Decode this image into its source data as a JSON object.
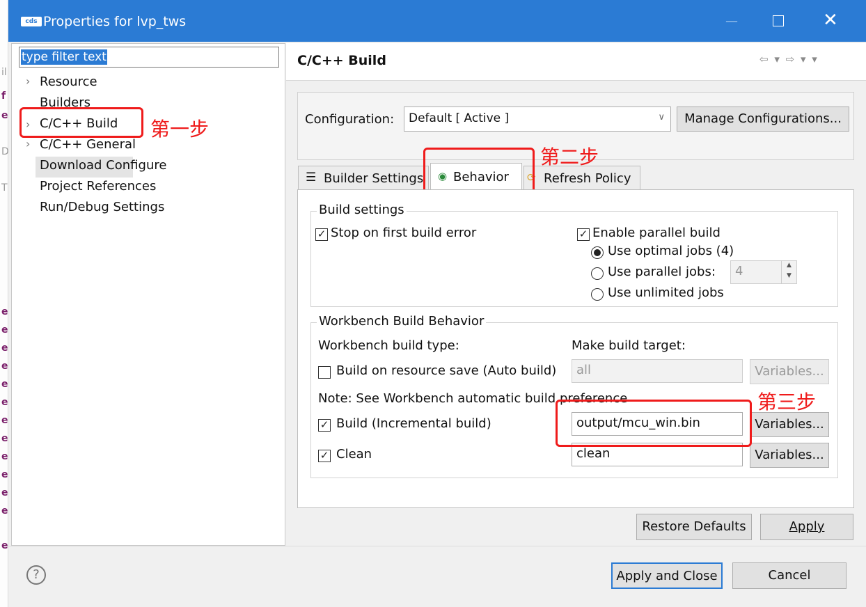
{
  "window": {
    "title": "Properties for lvp_tws",
    "logo": "cds"
  },
  "filter": {
    "value": "type filter text"
  },
  "tree": [
    {
      "label": "Resource",
      "expandable": true
    },
    {
      "label": "Builders",
      "expandable": false
    },
    {
      "label": "C/C++ Build",
      "expandable": true,
      "selected": true
    },
    {
      "label": "C/C++ General",
      "expandable": true
    },
    {
      "label": "Download Configure",
      "expandable": false
    },
    {
      "label": "Project References",
      "expandable": false
    },
    {
      "label": "Run/Debug Settings",
      "expandable": false
    }
  ],
  "annotations": {
    "step1": "第一步",
    "step2": "第二步",
    "step3": "第三步"
  },
  "page": {
    "title": "C/C++ Build"
  },
  "config": {
    "label": "Configuration:",
    "value": "Default  [ Active ]",
    "manage_label": "Manage Configurations..."
  },
  "tabs": [
    {
      "label": "Builder Settings",
      "icon": "list-icon"
    },
    {
      "label": "Behavior",
      "icon": "radio-dot-icon",
      "active": true
    },
    {
      "label": "Refresh Policy",
      "icon": "refresh-icon"
    }
  ],
  "build_settings": {
    "title": "Build settings",
    "stop_on_error": {
      "label": "Stop on first build error",
      "checked": true
    },
    "parallel": {
      "label": "Enable parallel build",
      "checked": true
    },
    "optimal": {
      "label": "Use optimal jobs (4)",
      "selected": true
    },
    "parallel_jobs": {
      "label": "Use parallel jobs:",
      "value": "4"
    },
    "unlimited": {
      "label": "Use unlimited jobs"
    }
  },
  "workbench": {
    "title": "Workbench Build Behavior",
    "type_label": "Workbench build type:",
    "target_label": "Make build target:",
    "auto": {
      "label": "Build on resource save (Auto build)",
      "value": "all",
      "checked": false
    },
    "note": "Note: See Workbench automatic build preference",
    "incremental": {
      "label": "Build (Incremental build)",
      "value": "output/mcu_win.bin",
      "checked": true
    },
    "clean": {
      "label": "Clean",
      "value": "clean",
      "checked": true
    },
    "variables_label": "Variables..."
  },
  "buttons": {
    "restore": "Restore Defaults",
    "apply": "Apply",
    "apply_close": "Apply and Close",
    "cancel": "Cancel",
    "help": "?"
  },
  "colors": {
    "titlebar": "#2b7bd4",
    "annotation": "#ef1b1b"
  }
}
